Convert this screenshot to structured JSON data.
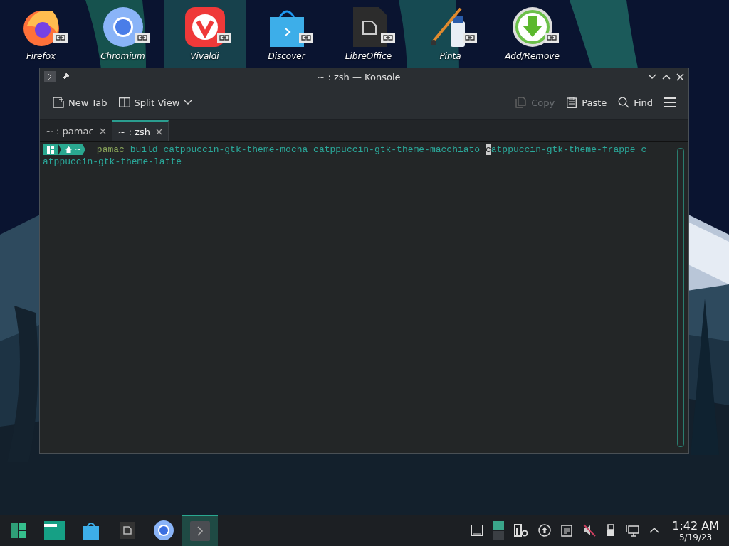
{
  "desktop_icons": [
    {
      "label": "Firefox",
      "kind": "firefox",
      "selected": false
    },
    {
      "label": "Chromium",
      "kind": "chromium",
      "selected": false
    },
    {
      "label": "Vivaldi",
      "kind": "vivaldi",
      "selected": true
    },
    {
      "label": "Discover",
      "kind": "discover",
      "selected": false
    },
    {
      "label": "LibreOffice",
      "kind": "libreoffice",
      "selected": false
    },
    {
      "label": "Pinta",
      "kind": "pinta",
      "selected": false
    },
    {
      "label": "Add/Remove",
      "kind": "addremove",
      "selected": false
    }
  ],
  "window": {
    "title": "~ : zsh — Konsole",
    "toolbar": [
      {
        "label": "New Tab",
        "kind": "new-tab",
        "disabled": false
      },
      {
        "label": "Split View",
        "kind": "split-view",
        "disabled": false
      },
      {
        "label": "Copy",
        "kind": "copy",
        "disabled": true
      },
      {
        "label": "Paste",
        "kind": "paste",
        "disabled": false
      },
      {
        "label": "Find",
        "kind": "find",
        "disabled": false
      }
    ],
    "tabs": [
      {
        "label": "~ : pamac",
        "selected": false
      },
      {
        "label": "~ : zsh",
        "selected": true
      }
    ],
    "terminal": {
      "prompt_dir": "~",
      "command": "pamac",
      "args": "build catppuccin-gtk-theme-mocha catppuccin-gtk-theme-macchiato ",
      "cursor_char": "c",
      "rest": "atppuccin-gtk-theme-frappe c",
      "line_2": "atppuccin-gtk-theme-latte"
    }
  },
  "taskbar": {
    "apps": [
      {
        "kind": "menu",
        "selected": false
      },
      {
        "kind": "files",
        "selected": false
      },
      {
        "kind": "discover",
        "selected": false
      },
      {
        "kind": "libreoffice",
        "selected": false
      },
      {
        "kind": "chromium",
        "selected": false
      },
      {
        "kind": "konsole",
        "selected": true
      }
    ],
    "tray": [
      {
        "kind": "desktop"
      },
      {
        "kind": "pager"
      },
      {
        "kind": "settings"
      },
      {
        "kind": "updates"
      },
      {
        "kind": "clipboard"
      },
      {
        "kind": "muted"
      },
      {
        "kind": "usb"
      },
      {
        "kind": "network"
      },
      {
        "kind": "expand"
      }
    ],
    "time": "1:42 AM",
    "date": "5/19/23"
  }
}
